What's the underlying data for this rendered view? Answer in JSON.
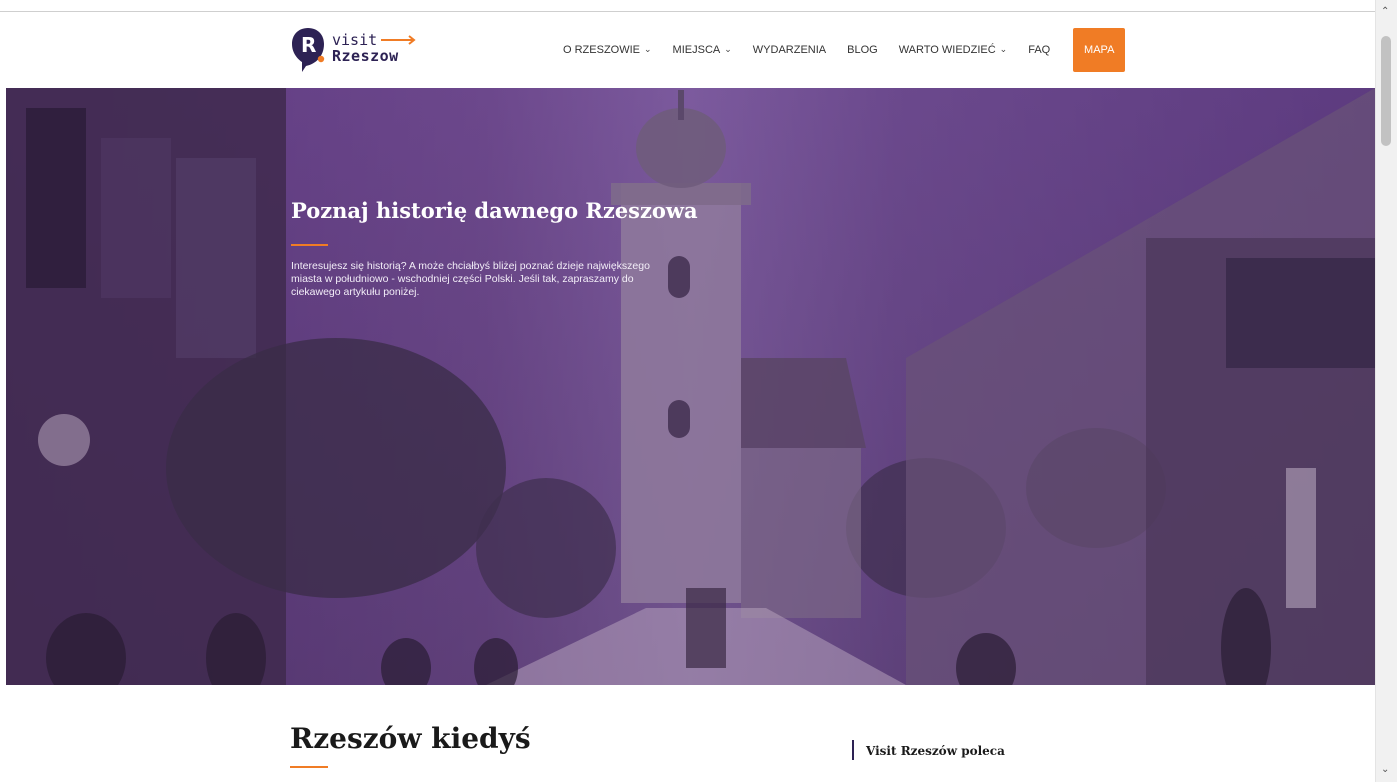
{
  "header": {
    "logo": {
      "line1": "visit",
      "line2": "Rzeszow",
      "mark": "R"
    },
    "nav": [
      {
        "label": "O RZESZOWIE",
        "has_dropdown": true
      },
      {
        "label": "MIEJSCA",
        "has_dropdown": true
      },
      {
        "label": "WYDARZENIA",
        "has_dropdown": false
      },
      {
        "label": "BLOG",
        "has_dropdown": false
      },
      {
        "label": "WARTO WIEDZIEĆ",
        "has_dropdown": true
      },
      {
        "label": "FAQ",
        "has_dropdown": false
      }
    ],
    "cta_label": "MAPA"
  },
  "hero": {
    "title": "Poznaj historię dawnego Rzeszowa",
    "text": "Interesujesz się historią? A może chciałbyś bliżej poznać dzieje największego miasta w południowo - wschodniej części Polski. Jeśli tak, zapraszamy do ciekawego artykułu poniżej."
  },
  "content": {
    "section_title": "Rzeszów kiedyś",
    "aside_title": "Visit Rzeszów poleca"
  },
  "colors": {
    "accent": "#f07c25",
    "brand": "#2d2254",
    "hero_overlay": "#5f3791"
  },
  "icons": {
    "dropdown": "chevron-down-icon",
    "scroll_up": "scroll-up-arrow-icon",
    "scroll_down": "scroll-down-arrow-icon"
  }
}
